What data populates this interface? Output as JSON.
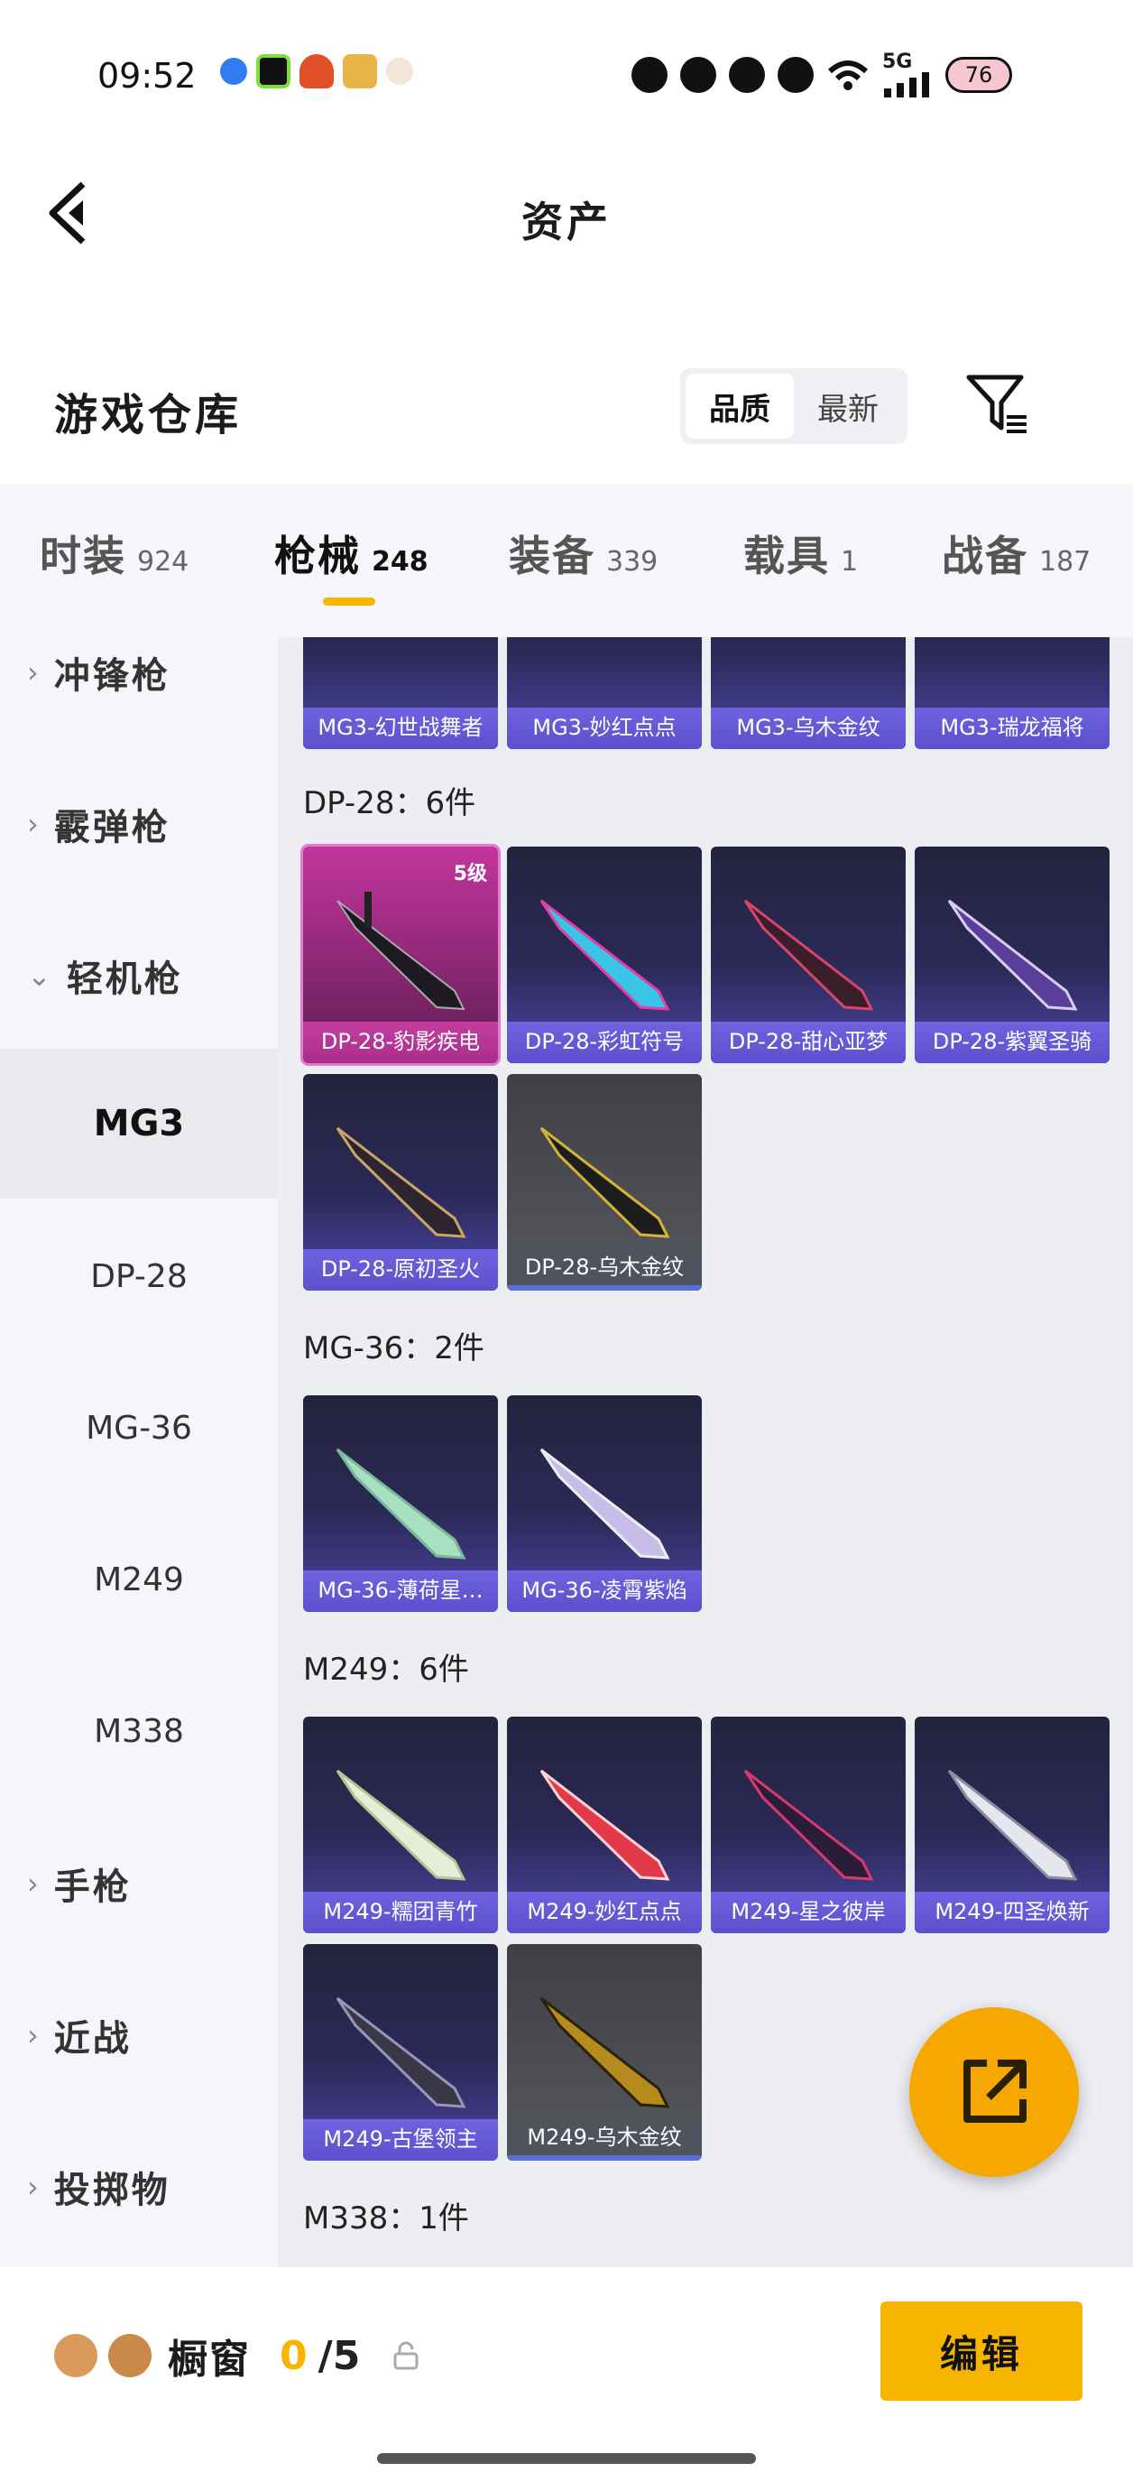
{
  "status_bar": {
    "time": "09:52",
    "network": "5G",
    "battery": "76"
  },
  "header": {
    "title": "资产"
  },
  "section": {
    "title": "游戏仓库"
  },
  "sort": {
    "options": [
      "品质",
      "最新"
    ],
    "active": "品质"
  },
  "tabs": [
    {
      "label": "时装",
      "count": "924"
    },
    {
      "label": "枪械",
      "count": "248",
      "active": true
    },
    {
      "label": "装备",
      "count": "339"
    },
    {
      "label": "载具",
      "count": "1"
    },
    {
      "label": "战备",
      "count": "187"
    }
  ],
  "sidebar": {
    "groups": [
      "冲锋枪",
      "霰弹枪",
      "轻机枪",
      "手枪",
      "近战",
      "投掷物"
    ],
    "subitems": [
      "MG3",
      "DP-28",
      "MG-36",
      "M249",
      "M338"
    ],
    "active_subitem": "MG3"
  },
  "content": {
    "top_partial_cards": [
      "MG3-幻世战舞者",
      "MG3-妙红点点",
      "MG3-乌木金纹",
      "MG3-瑞龙福将"
    ],
    "groups": [
      {
        "title": "DP-28：6件",
        "cards": [
          {
            "label": "DP-28-豹影疾电",
            "level": "5级",
            "style": "gold"
          },
          {
            "label": "DP-28-彩虹符号",
            "style": "purple"
          },
          {
            "label": "DP-28-甜心亚梦",
            "style": "purple"
          },
          {
            "label": "DP-28-紫翼圣骑",
            "style": "purple"
          },
          {
            "label": "DP-28-原初圣火",
            "style": "purple"
          },
          {
            "label": "DP-28-乌木金纹",
            "style": "gray"
          }
        ]
      },
      {
        "title": "MG-36：2件",
        "cards": [
          {
            "label": "MG-36-薄荷星…",
            "style": "purple"
          },
          {
            "label": "MG-36-凌霄紫焰",
            "style": "purple"
          }
        ]
      },
      {
        "title": "M249：6件",
        "cards": [
          {
            "label": "M249-糯团青竹",
            "style": "purple"
          },
          {
            "label": "M249-妙红点点",
            "style": "purple"
          },
          {
            "label": "M249-星之彼岸",
            "style": "purple"
          },
          {
            "label": "M249-四圣焕新",
            "style": "purple"
          },
          {
            "label": "M249-古堡领主",
            "style": "purple"
          },
          {
            "label": "M249-乌木金纹",
            "style": "gray"
          }
        ]
      },
      {
        "title": "M338：1件",
        "cards": []
      }
    ]
  },
  "bottom": {
    "label": "橱窗",
    "count_current": "0",
    "count_rest": "/5",
    "edit_label": "编辑"
  },
  "colors": {
    "accent": "#f7b500",
    "fab": "#f7a800",
    "card_purple": "#2b2957",
    "card_gold": "#c2359c"
  }
}
